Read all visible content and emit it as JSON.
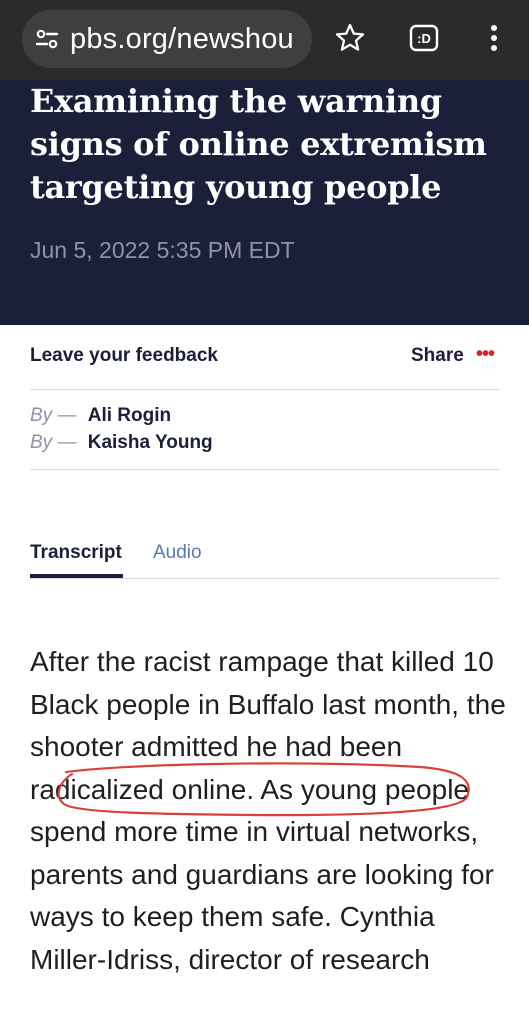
{
  "browser": {
    "url": "pbs.org/newshou",
    "site_icon": "site-settings-icon",
    "star_icon": "star-icon",
    "ext_icon": "tab-switcher-icon",
    "ext_label": ":D",
    "menu_icon": "more-vert-icon"
  },
  "article": {
    "title": "Examining the warning signs of online extremism targeting young people",
    "date": "Jun 5, 2022 5:35 PM EDT"
  },
  "actions": {
    "feedback": "Leave your feedback",
    "share": "Share",
    "more": "•••"
  },
  "authors": [
    {
      "prefix": "By —",
      "name": "Ali Rogin"
    },
    {
      "prefix": "By —",
      "name": "Kaisha Young"
    }
  ],
  "tabs": [
    "Transcript",
    "Audio"
  ],
  "transcript": {
    "pre": "After the racist rampage that killed 10 Black people in Buffalo last month, the shooter admitted he ",
    "highlighted": "had been radicalized online.",
    "post": " As young people spend more time in virtual networks, parents and guardians are looking for ways to keep them safe. Cynthia Miller-Idriss, director of research"
  },
  "colors": {
    "hero_bg": "#1b1f3a",
    "accent_red": "#d32626",
    "annotation": "#d9423a"
  }
}
